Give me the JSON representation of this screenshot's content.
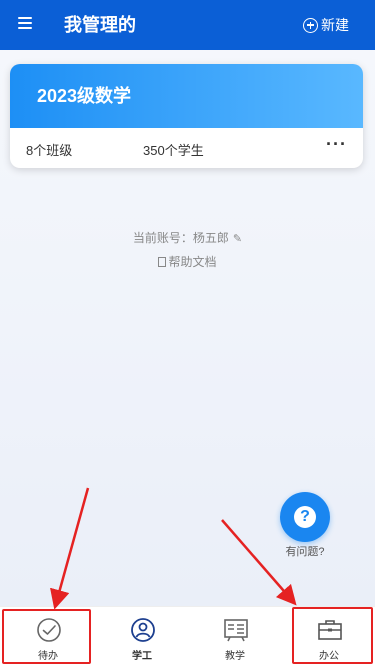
{
  "header": {
    "title": "我管理的",
    "new_label": "新建"
  },
  "course_card": {
    "title": "2023级数学",
    "classes": "8个班级",
    "students": "350个学生",
    "more": "···"
  },
  "account": {
    "text": "当前账号：杨五郎"
  },
  "help_doc": "帮助文档",
  "help_fab": {
    "icon": "?",
    "label": "有问题?"
  },
  "tabs": [
    {
      "label": "待办",
      "icon": "check-circle-icon"
    },
    {
      "label": "学工",
      "icon": "person-icon"
    },
    {
      "label": "教学",
      "icon": "board-icon"
    },
    {
      "label": "办公",
      "icon": "briefcase-icon"
    }
  ],
  "colors": {
    "header_bg": "#0b5fd6",
    "accent": "#1a86f0",
    "annotation_red": "#e52222"
  }
}
